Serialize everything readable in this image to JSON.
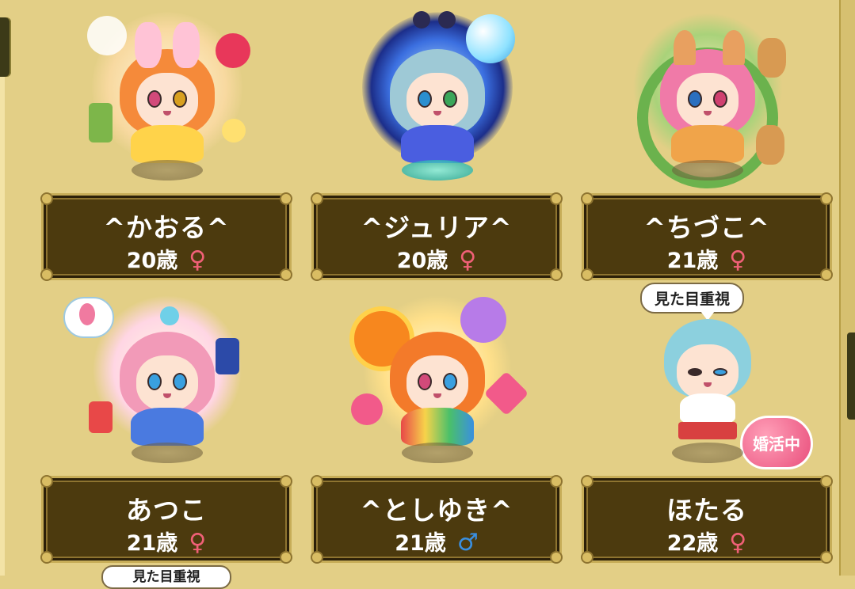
{
  "players": [
    {
      "name": "^かおる^",
      "age": "20歳",
      "gender_symbol": "♀",
      "gender": "female",
      "theme_color": "#ff8a3c",
      "accent": "#ff6fa0"
    },
    {
      "name": "^ジュリア^",
      "age": "20歳",
      "gender_symbol": "♀",
      "gender": "female",
      "theme_color": "#8cc8d8",
      "accent": "#4a6ae0"
    },
    {
      "name": "^ちづこ^",
      "age": "21歳",
      "gender_symbol": "♀",
      "gender": "female",
      "theme_color": "#f07aa8",
      "accent": "#7bc26a"
    },
    {
      "name": "あつこ",
      "age": "21歳",
      "gender_symbol": "♀",
      "gender": "female",
      "theme_color": "#f29ab8",
      "accent": "#5fb6e8"
    },
    {
      "name": "^としゆき^",
      "age": "21歳",
      "gender_symbol": "♂",
      "gender": "male",
      "theme_color": "#f37a2a",
      "accent": "#f7d34a"
    },
    {
      "name": "ほたる",
      "age": "22歳",
      "gender_symbol": "♀",
      "gender": "female",
      "theme_color": "#8cd0de",
      "accent": "#ffffff"
    }
  ],
  "status_bubble": "見た目重視",
  "marriage_badge": "婚活中",
  "partial_bubble": "見た目重視",
  "colors": {
    "background": "#e3cf86",
    "nameplate": "#4c3a0e",
    "nameplate_border": "#c7ad58",
    "female": "#f06077",
    "male": "#3a8fe0"
  }
}
